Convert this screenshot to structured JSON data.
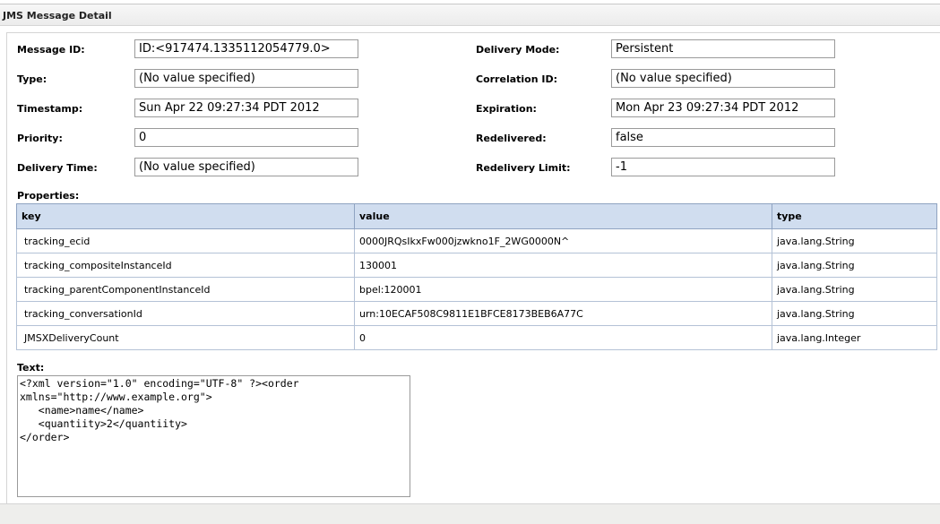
{
  "header": {
    "title": "JMS Message Detail"
  },
  "fields": {
    "message_id": {
      "label": "Message ID:",
      "value": "ID:<917474.1335112054779.0>"
    },
    "type": {
      "label": "Type:",
      "value": "(No value specified)"
    },
    "timestamp": {
      "label": "Timestamp:",
      "value": "Sun Apr 22 09:27:34 PDT 2012"
    },
    "priority": {
      "label": "Priority:",
      "value": "0"
    },
    "delivery_time": {
      "label": "Delivery Time:",
      "value": "(No value specified)"
    },
    "delivery_mode": {
      "label": "Delivery Mode:",
      "value": "Persistent"
    },
    "correlation_id": {
      "label": "Correlation ID:",
      "value": "(No value specified)"
    },
    "expiration": {
      "label": "Expiration:",
      "value": "Mon Apr 23 09:27:34 PDT 2012"
    },
    "redelivered": {
      "label": "Redelivered:",
      "value": "false"
    },
    "redelivery_limit": {
      "label": "Redelivery Limit:",
      "value": "-1"
    }
  },
  "properties": {
    "label": "Properties:",
    "columns": [
      "key",
      "value",
      "type"
    ],
    "rows": [
      {
        "key": "tracking_ecid",
        "value": "0000JRQsIkxFw000jzwkno1F_2WG0000N^",
        "type": "java.lang.String"
      },
      {
        "key": "tracking_compositeInstanceId",
        "value": "130001",
        "type": "java.lang.String"
      },
      {
        "key": "tracking_parentComponentInstanceId",
        "value": "bpel:120001",
        "type": "java.lang.String"
      },
      {
        "key": "tracking_conversationId",
        "value": "urn:10ECAF508C9811E1BFCE8173BEB6A77C",
        "type": "java.lang.String"
      },
      {
        "key": "JMSXDeliveryCount",
        "value": "0",
        "type": "java.lang.Integer"
      }
    ]
  },
  "text": {
    "label": "Text:",
    "content": "<?xml version=\"1.0\" encoding=\"UTF-8\" ?><order\nxmlns=\"http://www.example.org\">\n   <name>name</name>\n   <quantiity>2</quantiity>\n</order>"
  }
}
